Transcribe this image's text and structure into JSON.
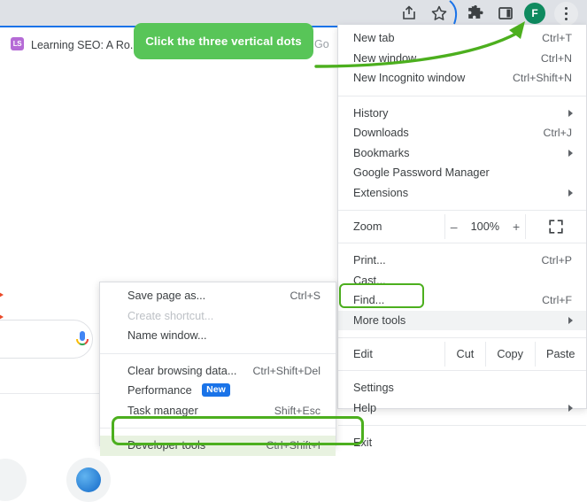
{
  "browser": {
    "tab": {
      "favicon_text": "LS",
      "title": "Learning SEO: A Ro...",
      "partial_text_behind_callout": "Go"
    },
    "toolbar": {
      "icons": [
        "share-icon",
        "star-icon",
        "extensions-icon",
        "side-panel-icon"
      ],
      "avatar_initial": "F",
      "menu_button": "three-dot-menu"
    }
  },
  "callout": {
    "text": "Click the three vertical dots",
    "color": "#58c558"
  },
  "annotation": {
    "arrow_color": "#4caf1e",
    "highlight_color": "#4caf1e"
  },
  "main_menu": {
    "groups": [
      {
        "items": [
          {
            "label": "New tab",
            "accel": "Ctrl+T",
            "submenu": false
          },
          {
            "label": "New window",
            "accel": "Ctrl+N",
            "submenu": false
          },
          {
            "label": "New Incognito window",
            "accel": "Ctrl+Shift+N",
            "submenu": false
          }
        ]
      },
      {
        "items": [
          {
            "label": "History",
            "accel": "",
            "submenu": true
          },
          {
            "label": "Downloads",
            "accel": "Ctrl+J",
            "submenu": false
          },
          {
            "label": "Bookmarks",
            "accel": "",
            "submenu": true
          },
          {
            "label": "Google Password Manager",
            "accel": "",
            "submenu": false
          },
          {
            "label": "Extensions",
            "accel": "",
            "submenu": true
          }
        ]
      }
    ],
    "zoom_row": {
      "label": "Zoom",
      "minus": "–",
      "value": "100%",
      "plus": "+",
      "fullscreen": "fullscreen-icon"
    },
    "group3": {
      "items": [
        {
          "label": "Print...",
          "accel": "Ctrl+P",
          "submenu": false
        },
        {
          "label": "Cast...",
          "accel": "",
          "submenu": false
        },
        {
          "label": "Find...",
          "accel": "Ctrl+F",
          "submenu": false
        },
        {
          "label": "More tools",
          "accel": "",
          "submenu": true,
          "highlighted": true
        }
      ]
    },
    "edit_row": {
      "label": "Edit",
      "cut": "Cut",
      "copy": "Copy",
      "paste": "Paste"
    },
    "group4": {
      "items": [
        {
          "label": "Settings",
          "accel": "",
          "submenu": false
        },
        {
          "label": "Help",
          "accel": "",
          "submenu": true
        }
      ]
    },
    "group5": {
      "items": [
        {
          "label": "Exit",
          "accel": "",
          "submenu": false
        }
      ]
    }
  },
  "submenu": {
    "groups": [
      {
        "items": [
          {
            "label": "Save page as...",
            "accel": "Ctrl+S",
            "disabled": false
          },
          {
            "label": "Create shortcut...",
            "accel": "",
            "disabled": true
          },
          {
            "label": "Name window...",
            "accel": "",
            "disabled": false
          }
        ]
      },
      {
        "items": [
          {
            "label": "Clear browsing data...",
            "accel": "Ctrl+Shift+Del",
            "disabled": false
          },
          {
            "label": "Performance",
            "accel": "",
            "disabled": false,
            "badge": "New"
          },
          {
            "label": "Task manager",
            "accel": "Shift+Esc",
            "disabled": false
          }
        ]
      },
      {
        "items": [
          {
            "label": "Developer tools",
            "accel": "Ctrl+Shift+I",
            "disabled": false,
            "highlighted": true
          }
        ]
      }
    ]
  }
}
